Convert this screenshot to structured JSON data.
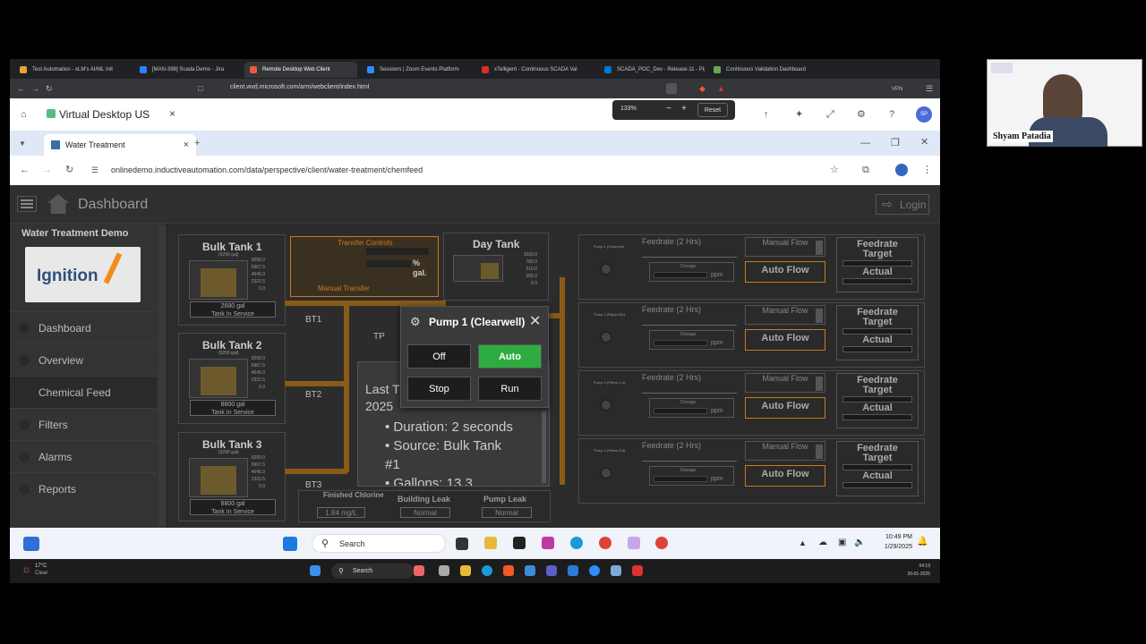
{
  "outer_browser": {
    "tabs": [
      {
        "label": "Test Automation - xLM's AI/ML Init",
        "color": "#e8a33d"
      },
      {
        "label": "[MAN-398] Scada Demo - Jira",
        "color": "#2684ff"
      },
      {
        "label": "Remote Desktop Web Client",
        "color": "#e85d3d"
      },
      {
        "label": "Sessions | Zoom Events Platform",
        "color": "#2d8cff"
      },
      {
        "label": "xTelligent - Continuous SCADA Val",
        "color": "#d93025"
      },
      {
        "label": "SCADA_POC_Dev - Release-11 - Pip",
        "color": "#0078d4"
      },
      {
        "label": "Continuous Validation Dashboard",
        "color": "#6aa84f"
      }
    ],
    "url": "client.wvd.microsoft.com/arm/webclient/index.html",
    "vpn": "VPN"
  },
  "remote_desktop": {
    "title": "Virtual Desktop US",
    "close": "×",
    "zoom": {
      "level": "133%",
      "minus": "−",
      "plus": "+",
      "reset": "Reset"
    },
    "avatar": "SP"
  },
  "inner_browser": {
    "tab": "Water Treatment",
    "new_tab": "+",
    "url": "onlinedemo.inductiveautomation.com/data/perspective/client/water-treatment/chemfeed"
  },
  "app": {
    "title": "Dashboard",
    "login": "Login",
    "sidebar_title": "Water Treatment Demo",
    "logo_text": "Ignition",
    "nav": [
      "Dashboard",
      "Overview",
      "Chemical Feed",
      "Filters",
      "Alarms",
      "Reports"
    ],
    "tanks": [
      {
        "name": "Bulk Tank 1",
        "cap": "(9290 gal)",
        "scale": [
          "9290.0",
          "6967.5",
          "4645.0",
          "2322.5",
          "0.0"
        ],
        "value": "2680 gal",
        "status": "Tank In Service"
      },
      {
        "name": "Bulk Tank 2",
        "cap": "(9290 gal)",
        "scale": [
          "9290.0",
          "6967.5",
          "4645.0",
          "2322.5",
          "0.0"
        ],
        "value": "8800 gal",
        "status": "Tank In Service"
      },
      {
        "name": "Bulk Tank 3",
        "cap": "(9290 gal)",
        "scale": [
          "9290.0",
          "6967.5",
          "4645.0",
          "2322.5",
          "0.0"
        ],
        "value": "8800 gal",
        "status": "Tank In Service"
      }
    ],
    "transfer": {
      "title": "Transfer Controls",
      "pct": "%",
      "gal": "gal.",
      "manual": "Manual Transfer"
    },
    "day_tank": {
      "name": "Day Tank",
      "scale": [
        "1020.0",
        "765.0",
        "510.0",
        "255.0",
        "0.0"
      ]
    },
    "pipes": [
      "BT1",
      "BT2",
      "BT3",
      "TP"
    ],
    "pumps": [
      {
        "name": "Pump 1 (Clearwell)",
        "feedrate": "Feedrate (2 Hrs)",
        "dosage": "Dosage",
        "ppm": "ppm",
        "manual": "Manual Flow",
        "auto": "Auto Flow",
        "target": "Feedrate Target",
        "actual": "Actual"
      },
      {
        "name": "Pump 2 (Rapid Mix)",
        "feedrate": "Feedrate (2 Hrs)",
        "dosage": "Dosage",
        "ppm": "ppm",
        "manual": "Manual Flow",
        "auto": "Auto Flow",
        "target": "Feedrate Target",
        "actual": "Actual"
      },
      {
        "name": "Pump 3 (Filters 1-4)",
        "feedrate": "Feedrate (2 Hrs)",
        "dosage": "Dosage",
        "ppm": "ppm",
        "manual": "Manual Flow",
        "auto": "Auto Flow",
        "target": "Feedrate Target",
        "actual": "Actual"
      },
      {
        "name": "Pump 4 (Filters 5-8)",
        "feedrate": "Feedrate (2 Hrs)",
        "dosage": "Dosage",
        "ppm": "ppm",
        "manual": "Manual Flow",
        "auto": "Auto Flow",
        "target": "Feedrate Target",
        "actual": "Actual"
      }
    ],
    "status": {
      "finished": "Finished Chlorine",
      "finished_val": "1.84 mg/L",
      "building_leak": "Building Leak",
      "building_val": "Normal",
      "pump_leak": "Pump Leak",
      "pump_val": "Normal"
    },
    "modal": {
      "title": "Pump 1 (Clearwell)",
      "off": "Off",
      "auto": "Auto",
      "stop": "Stop",
      "run": "Run"
    },
    "info": {
      "last": "Last T",
      "year": "2025",
      "items": [
        "Duration: 2 seconds",
        "Source: Bulk Tank",
        "#1",
        "Gallons: 13.3"
      ]
    }
  },
  "taskbar": {
    "search": "Search",
    "time": "10:49 PM",
    "date": "1/29/2025"
  },
  "taskbar_host": {
    "weather_temp": "17°C",
    "weather_desc": "Clear",
    "search": "Search",
    "time": "04:19",
    "date": "30-01-2025"
  },
  "webcam": {
    "name": "Shyam Patadia"
  }
}
